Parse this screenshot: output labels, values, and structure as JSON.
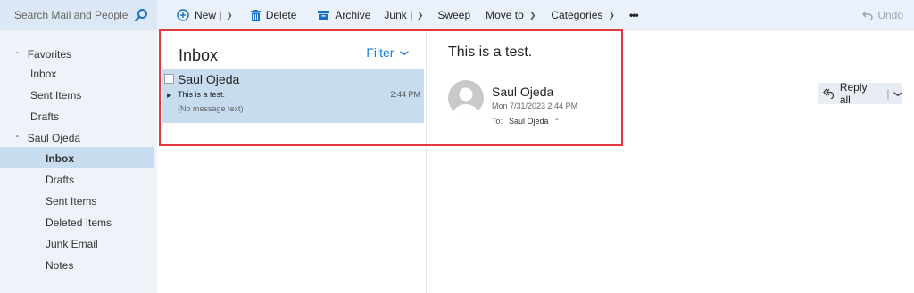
{
  "search": {
    "placeholder": "Search Mail and People"
  },
  "toolbar": {
    "new_label": "New",
    "delete_label": "Delete",
    "archive_label": "Archive",
    "junk_label": "Junk",
    "sweep_label": "Sweep",
    "moveto_label": "Move to",
    "categories_label": "Categories",
    "more_label": "•••",
    "undo_label": "Undo"
  },
  "nav": {
    "favorites_header": "Favorites",
    "favorites": [
      "Inbox",
      "Sent Items",
      "Drafts"
    ],
    "account_header": "Saul Ojeda",
    "folders": [
      "Inbox",
      "Drafts",
      "Sent Items",
      "Deleted Items",
      "Junk Email",
      "Notes"
    ],
    "selected_folder": "Inbox"
  },
  "list": {
    "title": "Inbox",
    "filter_label": "Filter",
    "messages": [
      {
        "sender": "Saul Ojeda",
        "subject": "This is a test.",
        "time": "2:44 PM",
        "preview": "(No message text)"
      }
    ]
  },
  "reading": {
    "subject": "This is a test.",
    "from_name": "Saul Ojeda",
    "date": "Mon 7/31/2023 2:44 PM",
    "to_label": "To:",
    "to_name": "Saul Ojeda",
    "reply_all_label": "Reply all"
  },
  "colors": {
    "accent": "#1b7ad3",
    "selection": "#c8dcf0",
    "highlight_border": "#e03a3e"
  }
}
